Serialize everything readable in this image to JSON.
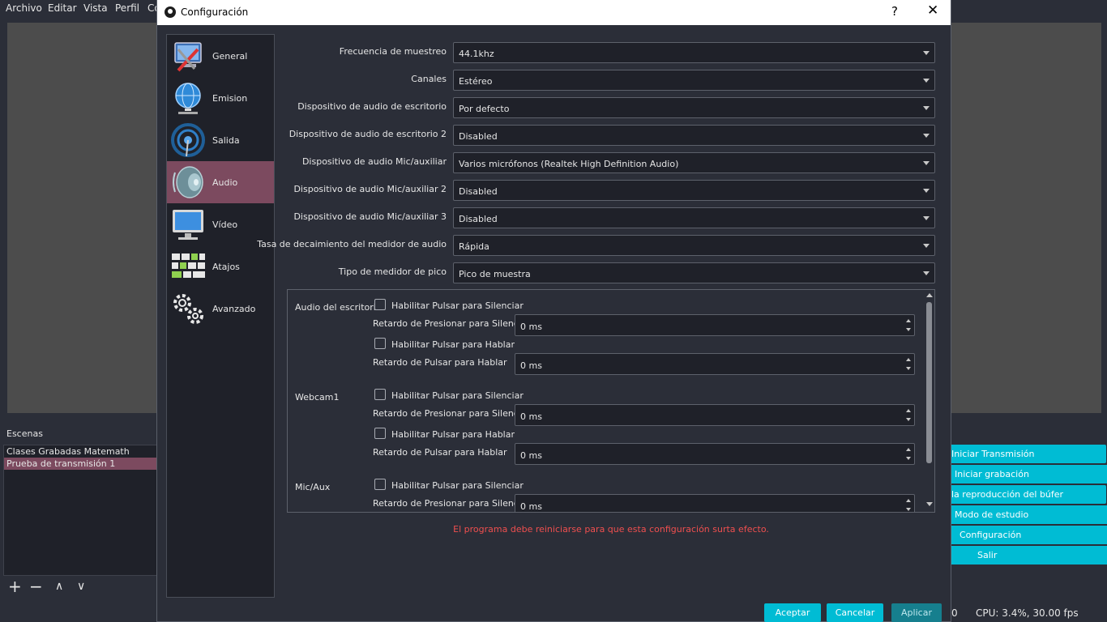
{
  "main": {
    "menu": [
      "Archivo",
      "Editar",
      "Vista",
      "Perfil",
      "Co"
    ],
    "scenes_title": "Escenas",
    "scenes": [
      {
        "label": "Clases Grabadas Matemath",
        "selected": false
      },
      {
        "label": "Prueba de transmisión 1",
        "selected": true
      }
    ],
    "scene_tools": {
      "add": "+",
      "remove": "−",
      "up": "∧",
      "down": "∨"
    },
    "controls": [
      "Iniciar Transmisión",
      "Iniciar grabación",
      "la reproducción del búfer",
      "Modo de estudio",
      "Configuración",
      "Salir"
    ],
    "status": {
      "left": "0",
      "cpu": "CPU: 3.4%, 30.00 fps"
    },
    "accent": "#00bcd4"
  },
  "dialog": {
    "title": "Configuración",
    "help": "?",
    "close": "✕",
    "nav": [
      {
        "label": "General",
        "icon": "general-icon",
        "active": false
      },
      {
        "label": "Emision",
        "icon": "globe-icon",
        "active": false
      },
      {
        "label": "Salida",
        "icon": "broadcast-icon",
        "active": false
      },
      {
        "label": "Audio",
        "icon": "speaker-icon",
        "active": true
      },
      {
        "label": "Vídeo",
        "icon": "monitor-icon",
        "active": false
      },
      {
        "label": "Atajos",
        "icon": "keyboard-icon",
        "active": false
      },
      {
        "label": "Avanzado",
        "icon": "gears-icon",
        "active": false
      }
    ],
    "fields": [
      {
        "label": "Frecuencia de muestreo",
        "value": "44.1khz"
      },
      {
        "label": "Canales",
        "value": "Estéreo"
      },
      {
        "label": "Dispositivo de audio de escritorio",
        "value": "Por defecto"
      },
      {
        "label": "Dispositivo de audio de escritorio 2",
        "value": "Disabled"
      },
      {
        "label": "Dispositivo de audio Mic/auxiliar",
        "value": "Varios micrófonos (Realtek High Definition Audio)"
      },
      {
        "label": "Dispositivo de audio Mic/auxiliar 2",
        "value": "Disabled"
      },
      {
        "label": "Dispositivo de audio Mic/auxiliar 3",
        "value": "Disabled"
      },
      {
        "label": "Tasa de decaimiento del medidor de audio",
        "value": "Rápida"
      },
      {
        "label": "Tipo de medidor de pico",
        "value": "Pico de muestra"
      }
    ],
    "hotkeys": {
      "groups": [
        {
          "name": "Audio del escritorio",
          "mute_check": "Habilitar Pulsar para Silenciar",
          "mute_delay_label": "Retardo de Presionar para Silenciar",
          "mute_delay": "0 ms",
          "talk_check": "Habilitar Pulsar para Hablar",
          "talk_delay_label": "Retardo de Pulsar para Hablar",
          "talk_delay": "0 ms"
        },
        {
          "name": "Webcam1",
          "mute_check": "Habilitar Pulsar para Silenciar",
          "mute_delay_label": "Retardo de Presionar para Silenciar",
          "mute_delay": "0 ms",
          "talk_check": "Habilitar Pulsar para Hablar",
          "talk_delay_label": "Retardo de Pulsar para Hablar",
          "talk_delay": "0 ms"
        },
        {
          "name": "Mic/Aux",
          "mute_check": "Habilitar Pulsar para Silenciar",
          "mute_delay_label": "Retardo de Presionar para Silenciar",
          "mute_delay": "0 ms"
        }
      ]
    },
    "warning": "El programa debe reiniciarse para que esta configuración surta efecto.",
    "buttons": {
      "accept": "Aceptar",
      "cancel": "Cancelar",
      "apply": "Aplicar"
    },
    "warning_color": "#ef4f4f",
    "active_nav_color": "#7c4a5f"
  }
}
